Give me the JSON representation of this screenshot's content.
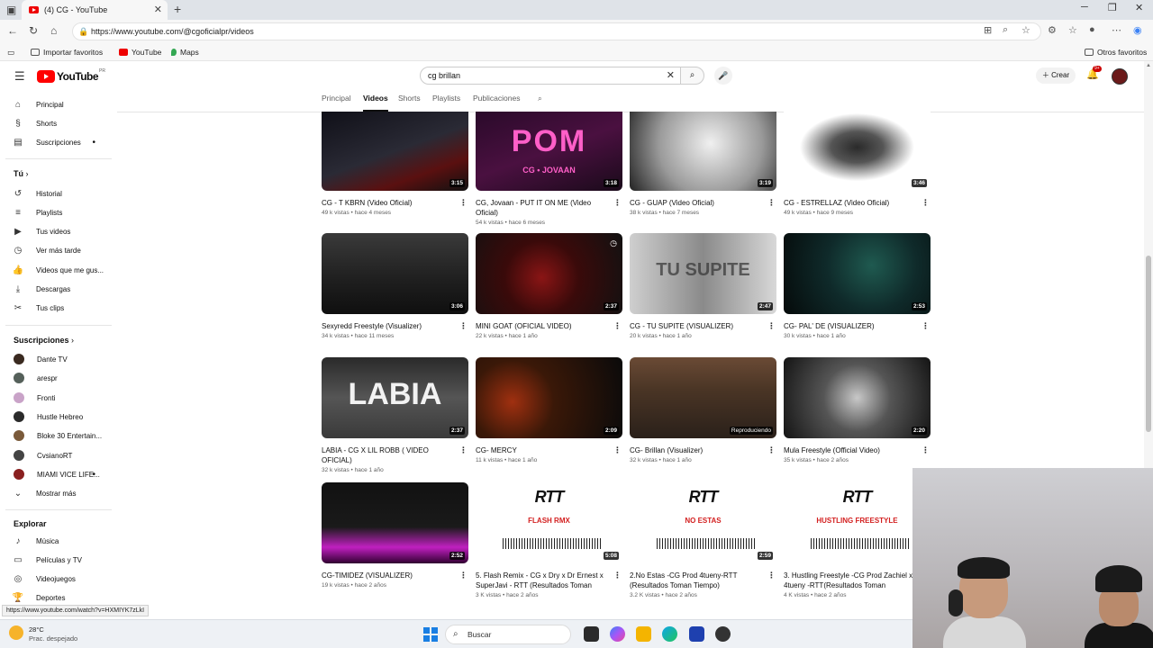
{
  "browser": {
    "tab_title": "(4) CG - YouTube",
    "url": "https://www.youtube.com/@cgoficialpr/videos",
    "bookmarks": [
      "Importar favoritos",
      "YouTube",
      "Maps"
    ],
    "other_bookmarks": "Otros favoritos"
  },
  "header": {
    "logo_text": "YouTube",
    "country_code": "PR",
    "search_value": "cg brillan",
    "create_label": "Crear",
    "notif_count": "9+"
  },
  "sidebar": {
    "main": [
      {
        "label": "Principal",
        "icon": "home-icon"
      },
      {
        "label": "Shorts",
        "icon": "shorts-icon"
      },
      {
        "label": "Suscripciones",
        "icon": "subscriptions-icon"
      }
    ],
    "you_header": "Tú",
    "you": [
      {
        "label": "Historial"
      },
      {
        "label": "Playlists"
      },
      {
        "label": "Tus videos"
      },
      {
        "label": "Ver más tarde"
      },
      {
        "label": "Videos que me gus..."
      },
      {
        "label": "Descargas"
      },
      {
        "label": "Tus clips"
      }
    ],
    "subs_header": "Suscripciones",
    "subs": [
      {
        "label": "Dante TV",
        "color": "#3a2a20"
      },
      {
        "label": "arespr",
        "color": "#55605a"
      },
      {
        "label": "Fronti",
        "color": "#c9a3c8"
      },
      {
        "label": "Hustle Hebreo",
        "color": "#2b2b2b"
      },
      {
        "label": "Bloke 30 Entertain...",
        "color": "#7a5a3a"
      },
      {
        "label": "CvsianoRT",
        "color": "#444444"
      },
      {
        "label": "MIAMI VICE LIFE...",
        "color": "#8a2020"
      }
    ],
    "show_more": "Mostrar más",
    "explore_header": "Explorar",
    "explore": [
      {
        "label": "Música"
      },
      {
        "label": "Películas y TV"
      },
      {
        "label": "Videojuegos"
      },
      {
        "label": "Deportes"
      }
    ]
  },
  "channel_tabs": [
    "Principal",
    "Videos",
    "Shorts",
    "Playlists",
    "Publicaciones"
  ],
  "videos": [
    {
      "title": "CG - T KBRN (Video Oficial)",
      "meta": "49 k vistas • hace 4 meses",
      "duration": "3:15",
      "bg": "linear-gradient(160deg,#101018 0%,#2a2a35 50%,#5a1010 75%,#111 100%)"
    },
    {
      "title": "CG, Jovaan - PUT IT ON ME (Video Oficial)",
      "meta": "54 k vistas • hace 6 meses",
      "duration": "3:18",
      "bg": "linear-gradient(160deg,#2a0a2a 0%,#4a1040 50%,#1a0a1a 100%)",
      "overlay": "POM",
      "overlay2": "CG • JOVAAN"
    },
    {
      "title": "CG - GUAP (Video Oficial)",
      "meta": "38 k vistas • hace 7 meses",
      "duration": "3:19",
      "bg": "radial-gradient(circle at 55% 40%,#f0f0f0 0%,#9a9a9a 55%,#222 100%)"
    },
    {
      "title": "CG - ESTRELLAZ (Video Oficial)",
      "meta": "49 k vistas • hace 9 meses",
      "duration": "3:46",
      "bg": "radial-gradient(ellipse at 50% 45%,#2a2a2a 0%,#555 25%,#ffffff 55%)"
    },
    {
      "title": "Sexyredd Freestyle (Visualizer)",
      "meta": "34 k vistas • hace 11 meses",
      "duration": "3:06",
      "bg": "linear-gradient(180deg,#3a3a3a 0%,#1e1e1e 60%,#0f0f0f 100%)"
    },
    {
      "title": "MINI GOAT (OFICIAL VIDEO)",
      "meta": "22 k vistas • hace 1 año",
      "duration": "2:37",
      "bg": "radial-gradient(circle at 45% 55%,#8a1515 0%,#3a0a0a 40%,#111 100%)"
    },
    {
      "title": "CG - TU SUPITE (VISUALIZER)",
      "meta": "20 k vistas • hace 1 año",
      "duration": "2:47",
      "bg": "linear-gradient(90deg,#cfcfcf 0%,#8a8a8a 50%,#d8d8d8 100%)",
      "overlay": "TU SUPITE"
    },
    {
      "title": "CG- PAL' DE (VISUALIZER)",
      "meta": "30 k vistas • hace 1 año",
      "duration": "2:53",
      "bg": "radial-gradient(circle at 60% 40%,#1f5a50 0%,#0f2a2a 45%,#050a0a 100%)"
    },
    {
      "title": "LABIA - CG X LIL ROBB ( VIDEO OFICIAL)",
      "meta": "32 k vistas • hace 1 año",
      "duration": "2:37",
      "bg": "linear-gradient(180deg,#2a2a2a 0%,#555 50%,#3a3a3a 100%)",
      "overlay": "LABIA"
    },
    {
      "title": "CG- MERCY",
      "meta": "11 k vistas • hace 1 año",
      "duration": "2:09",
      "bg": "radial-gradient(circle at 25% 55%,#a03010 0%,#3a1808 35%,#0a0a0a 100%)"
    },
    {
      "title": "CG- Brillan (Visualizer)",
      "meta": "32 k vistas • hace 1 año",
      "playing": "Reproduciendo",
      "bg": "linear-gradient(180deg,#6a4a35 0%,#4a3525 40%,#2a201a 100%)"
    },
    {
      "title": "Mula Freestyle (Official Video)",
      "meta": "35 k vistas • hace 2 años",
      "duration": "2:20",
      "bg": "radial-gradient(circle at 50% 50%,#c8c8c8 0%,#555 40%,#141414 100%)"
    },
    {
      "title": "CG-TIMIDEZ (VISUALIZER)",
      "meta": "19 k vistas • hace 2 años",
      "duration": "2:52",
      "bg": "linear-gradient(180deg,#111 0%,#1a1a1a 55%,#c020c0 80%,#300030 100%)"
    },
    {
      "title": "5. Flash Remix - CG x Dry x Dr Ernest x SuperJavi - RTT (Resultados Toman Tiempo)",
      "meta": "3 K vistas • hace 2 años",
      "duration": "5:08",
      "bg": "#ffffff",
      "rtt": true,
      "overlay": "FLASH RMX"
    },
    {
      "title": "2.No Estas -CG Prod 4tueny-RTT (Resultados Toman Tiempo)",
      "meta": "3.2 K vistas • hace 2 años",
      "duration": "2:59",
      "bg": "#ffffff",
      "rtt": true,
      "overlay": "NO ESTAS"
    },
    {
      "title": "3. Hustling Freestyle -CG Prod Zachiel x 4tueny -RTT(Resultados Toman Tiempo)...",
      "meta": "4 K vistas • hace 2 años",
      "bg": "#ffffff",
      "rtt": true,
      "overlay": "HUSTLING FREESTYLE"
    }
  ],
  "status_url": "https://www.youtube.com/watch?v=HXMIYK7zLkI",
  "taskbar": {
    "temperature": "28°C",
    "weather": "Prac. despejado",
    "search_label": "Buscar"
  }
}
